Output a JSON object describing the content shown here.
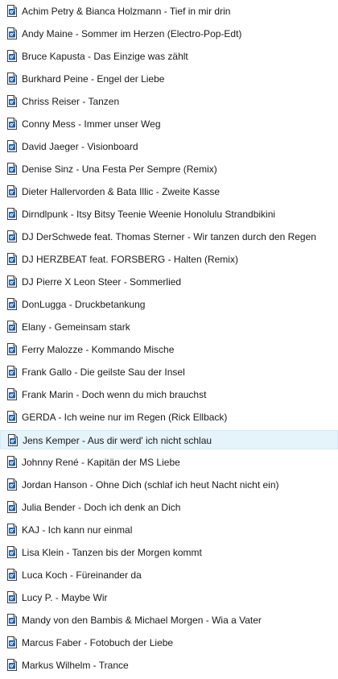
{
  "file_list": {
    "file_icon": "audio-file-icon",
    "selected_index": 19,
    "items": [
      "Achim Petry & Bianca Holzmann - Tief in mir drin",
      "Andy Maine - Sommer im Herzen (Electro-Pop-Edt)",
      "Bruce Kapusta - Das Einzige was zählt",
      "Burkhard Peine - Engel der Liebe",
      "Chriss Reiser - Tanzen",
      "Conny Mess - Immer unser Weg",
      "David Jaeger - Visionboard",
      "Denise Sinz - Una Festa Per Sempre (Remix)",
      "Dieter Hallervorden & Bata Illic - Zweite Kasse",
      "Dirndlpunk - Itsy Bitsy Teenie Weenie Honolulu Strandbikini",
      "DJ DerSchwede feat. Thomas Sterner - Wir tanzen durch den Regen",
      "DJ HERZBEAT feat. FORSBERG - Halten (Remix)",
      "DJ Pierre X Leon Steer - Sommerlied",
      "DonLugga - Druckbetankung",
      "Elany - Gemeinsam stark",
      "Ferry Malozze - Kommando Mische",
      "Frank Gallo - Die geilste Sau der Insel",
      "Frank Marin - Doch wenn du mich brauchst",
      "GERDA - Ich weine nur im Regen (Rick Ellback)",
      "Jens Kemper - Aus dir werd' ich nicht schlau",
      "Johnny René - Kapitän der MS Liebe",
      "Jordan Hanson - Ohne Dich (schlaf ich heut Nacht nicht ein)",
      "Julia Bender - Doch ich denk an Dich",
      "KAJ - Ich kann nur einmal",
      "Lisa Klein - Tanzen bis der Morgen kommt",
      "Luca Koch - Füreinander da",
      "Lucy P. - Maybe Wir",
      "Mandy von den Bambis & Michael Morgen - Wia a Vater",
      "Marcus Faber - Fotobuch der Liebe",
      "Markus Wilhelm - Trance"
    ]
  }
}
